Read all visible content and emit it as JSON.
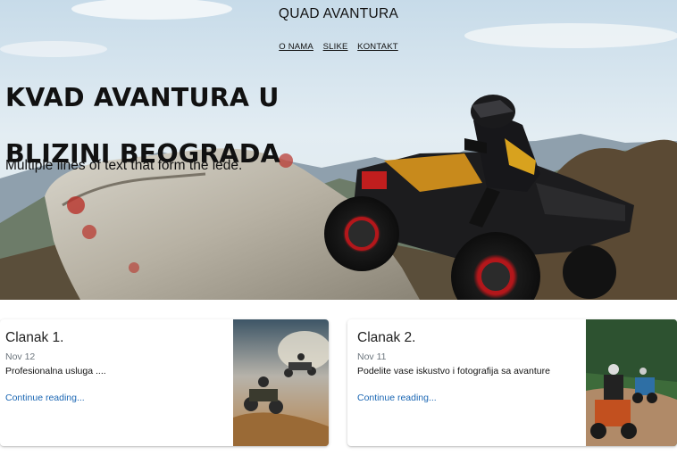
{
  "site": {
    "title": "QUAD AVANTURA"
  },
  "nav": {
    "items": [
      "O NAMA",
      "SLIKE",
      "KONTAKT"
    ]
  },
  "hero": {
    "title": "KVAD AVANTURA U BLIZINI BEOGRADA",
    "lede": "Multiple lines of text that form the lede."
  },
  "cards": [
    {
      "title": "Clanak 1.",
      "date": "Nov 12",
      "text": "Profesionalna usluga ....",
      "link": "Continue reading..."
    },
    {
      "title": "Clanak 2.",
      "date": "Nov 11",
      "text": "Podelite vase iskustvo i fotografija sa avanture",
      "link": "Continue reading..."
    }
  ],
  "colors": {
    "link": "#1a66b3",
    "muted": "#6c757d"
  }
}
